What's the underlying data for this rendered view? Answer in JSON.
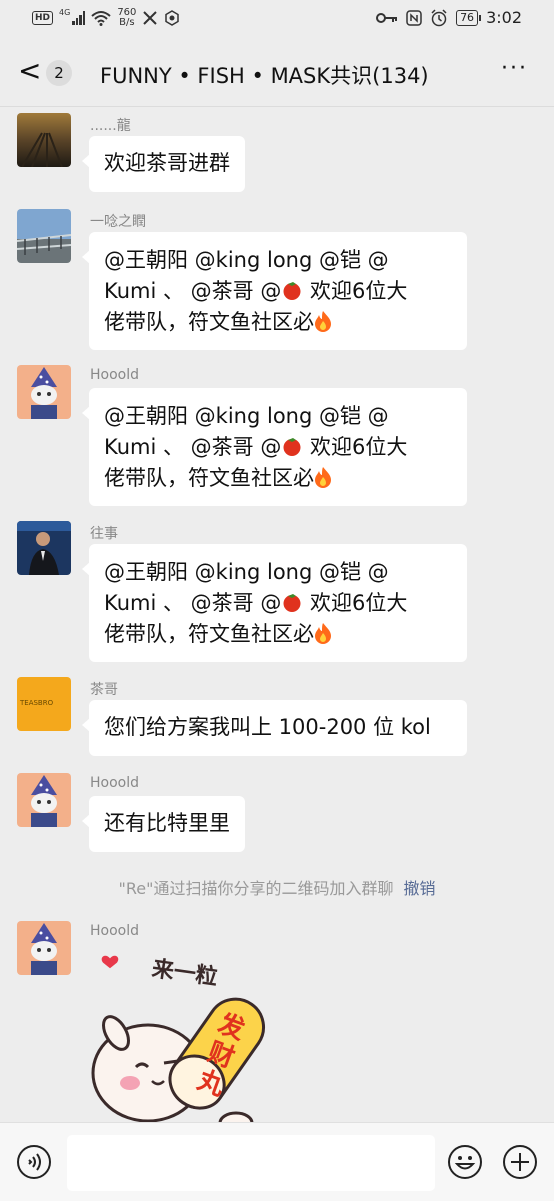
{
  "status_bar": {
    "hd": "HD",
    "network": "4G",
    "speed_value": "760",
    "speed_unit": "B/s",
    "battery": "76",
    "time": "3:02"
  },
  "header": {
    "back_glyph": "<",
    "unread_count": "2",
    "title": "FUNNY • FISH • MASK共识(134)",
    "more_glyph": "···"
  },
  "messages": [
    {
      "sender": "......龍",
      "text": "欢迎茶哥进群"
    },
    {
      "sender": "一唸之瞤",
      "line1": "@王朝阳 @king long @铠 @",
      "line2a": "Kumi 、 @茶哥 @",
      "line2b": " 欢迎6位大",
      "line3": "佬带队，符文鱼社区必"
    },
    {
      "sender": "Hooold",
      "line1": "@王朝阳 @king long @铠 @",
      "line2a": "Kumi 、 @茶哥 @",
      "line2b": " 欢迎6位大",
      "line3": "佬带队，符文鱼社区必"
    },
    {
      "sender": "往事",
      "line1": "@王朝阳 @king long @铠 @",
      "line2a": "Kumi 、 @茶哥 @",
      "line2b": " 欢迎6位大",
      "line3": "佬带队，符文鱼社区必"
    },
    {
      "sender": "茶哥",
      "text": "您们给方案我叫上 100-200 位 kol",
      "avatar_text": "TEASBRO"
    },
    {
      "sender": "Hooold",
      "text": "还有比特里里"
    }
  ],
  "system_notice": {
    "text": "\"Re\"通过扫描你分享的二维码加入群聊",
    "action": "撤销"
  },
  "sticker_message": {
    "sender": "Hooold",
    "sticker_text_top": "来一粒",
    "sticker_text_pill": "发财丸"
  },
  "input_bar": {
    "voice_icon": "voice-icon",
    "emoji_icon": "emoji-icon",
    "plus_icon": "plus-icon"
  }
}
